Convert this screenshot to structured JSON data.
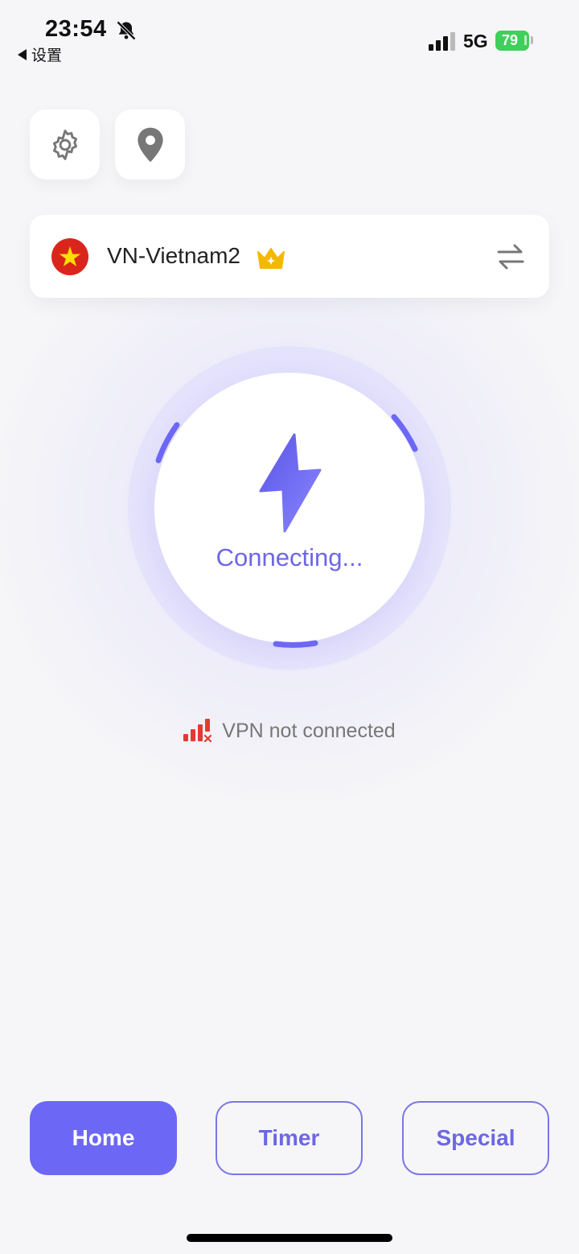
{
  "status_bar": {
    "time": "23:54",
    "back_label": "设置",
    "network": "5G",
    "battery": "79",
    "bell_icon": "bell-slash-icon",
    "signal_icon": "cellular-signal-icon"
  },
  "toolbar": {
    "settings_icon": "gear-icon",
    "location_icon": "location-pin-icon"
  },
  "server": {
    "name": "VN-Vietnam2",
    "flag_icon": "vietnam-flag-icon",
    "premium_icon": "crown-icon",
    "switch_icon": "swap-arrows-icon"
  },
  "connect": {
    "label": "Connecting...",
    "icon": "lightning-bolt-icon"
  },
  "vpn_status": {
    "text": "VPN not connected",
    "icon": "no-signal-icon"
  },
  "tabs": [
    {
      "label": "Home",
      "active": true
    },
    {
      "label": "Timer",
      "active": false
    },
    {
      "label": "Special",
      "active": false
    }
  ],
  "colors": {
    "accent": "#6d67f6",
    "accent_text": "#6d67e4",
    "battery": "#3fcf5a",
    "error": "#e53935",
    "background": "#f6f6f8"
  }
}
